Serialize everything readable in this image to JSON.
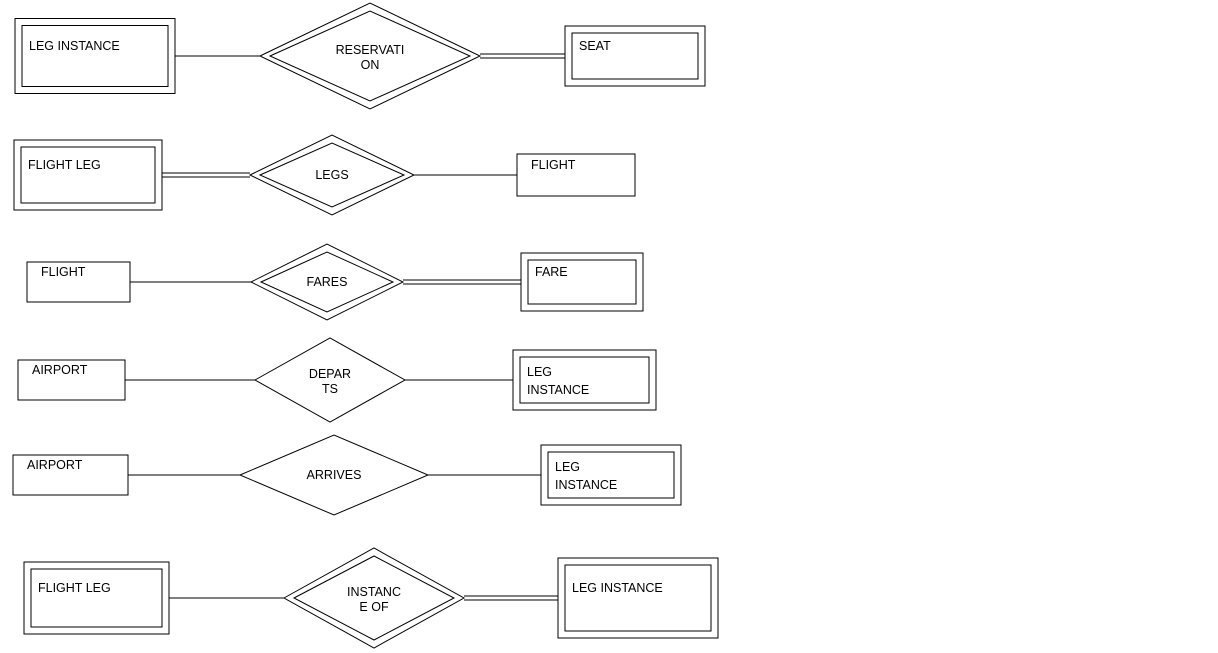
{
  "rows": [
    {
      "left": {
        "label": "LEG INSTANCE",
        "weak": true
      },
      "rel": {
        "label1": "RESERVATI",
        "label2": "ON",
        "identifying": true
      },
      "right": {
        "label": "SEAT",
        "weak": true
      },
      "leftLink": "single",
      "rightLink": "double"
    },
    {
      "left": {
        "label": "FLIGHT LEG",
        "weak": true
      },
      "rel": {
        "label1": "LEGS",
        "label2": "",
        "identifying": true
      },
      "right": {
        "label": "FLIGHT",
        "weak": false
      },
      "leftLink": "double",
      "rightLink": "single"
    },
    {
      "left": {
        "label": "FLIGHT",
        "weak": false
      },
      "rel": {
        "label1": "FARES",
        "label2": "",
        "identifying": true
      },
      "right": {
        "label": "FARE",
        "weak": true
      },
      "leftLink": "single",
      "rightLink": "double"
    },
    {
      "left": {
        "label": "AIRPORT",
        "weak": false
      },
      "rel": {
        "label1": "DEPAR",
        "label2": "TS",
        "identifying": false
      },
      "right": {
        "label1": "LEG",
        "label2": "INSTANCE",
        "weak": true
      },
      "leftLink": "single",
      "rightLink": "single"
    },
    {
      "left": {
        "label": "AIRPORT",
        "weak": false
      },
      "rel": {
        "label1": "ARRIVES",
        "label2": "",
        "identifying": false
      },
      "right": {
        "label1": "LEG",
        "label2": "INSTANCE",
        "weak": true
      },
      "leftLink": "single",
      "rightLink": "single"
    },
    {
      "left": {
        "label": "FLIGHT LEG",
        "weak": true
      },
      "rel": {
        "label1": "INSTANC",
        "label2": "E OF",
        "identifying": true
      },
      "right": {
        "label": "LEG INSTANCE",
        "weak": true
      },
      "leftLink": "single",
      "rightLink": "double"
    }
  ]
}
